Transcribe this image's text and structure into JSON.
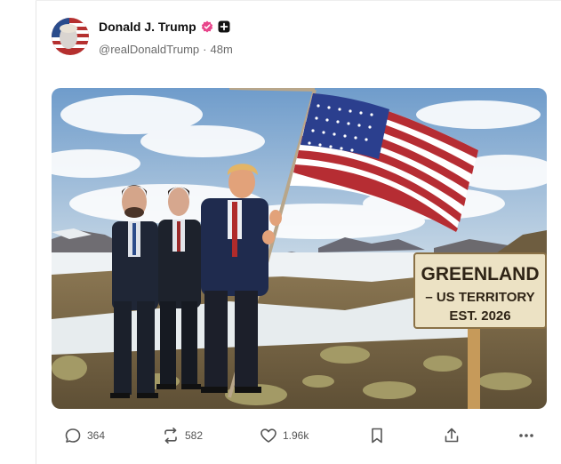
{
  "post": {
    "author": {
      "display_name": "Donald J. Trump",
      "handle": "@realDonaldTrump",
      "separator": "·",
      "time_ago": "48m"
    },
    "image": {
      "sign_lines": [
        "GREENLAND",
        "– US TERRITORY",
        "EST. 2026"
      ]
    },
    "actions": {
      "replies": "364",
      "reposts": "582",
      "likes": "1.96k"
    }
  },
  "colors": {
    "verified_badge": "#e8458b",
    "handle_text": "#6b6b6b",
    "action_icon": "#555555"
  },
  "icons": [
    "reply-icon",
    "repost-icon",
    "like-icon",
    "bookmark-icon",
    "share-icon",
    "more-icon",
    "verified-icon",
    "add-badge-icon"
  ]
}
